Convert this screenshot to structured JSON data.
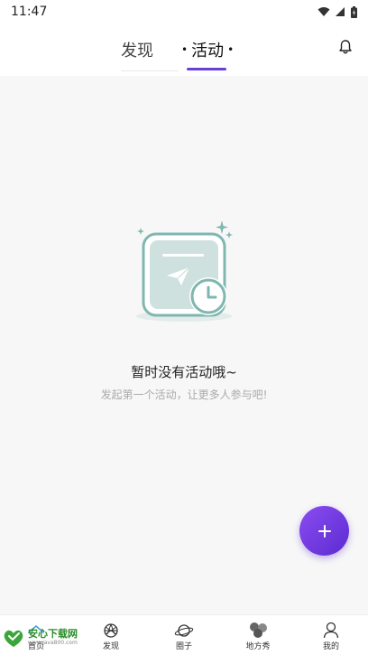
{
  "status_bar": {
    "time": "11:47"
  },
  "header": {
    "tabs": [
      {
        "label": "发现",
        "active": false
      },
      {
        "label": "活动",
        "active": true
      }
    ],
    "active_color": "#6b3fd6"
  },
  "empty_state": {
    "title": "暂时没有活动哦~",
    "subtitle": "发起第一个活动，让更多人参与吧!"
  },
  "fab": {
    "icon": "plus-icon",
    "color": "#7a3fe4"
  },
  "bottom_nav": {
    "items": [
      {
        "label": "首页",
        "icon": "home-icon"
      },
      {
        "label": "发现",
        "icon": "discover-icon"
      },
      {
        "label": "圈子",
        "icon": "planet-icon"
      },
      {
        "label": "地方秀",
        "icon": "local-show-icon"
      },
      {
        "label": "我的",
        "icon": "profile-icon"
      }
    ]
  },
  "watermark": {
    "brand": "安心下载网",
    "url": "www.java800.com"
  }
}
